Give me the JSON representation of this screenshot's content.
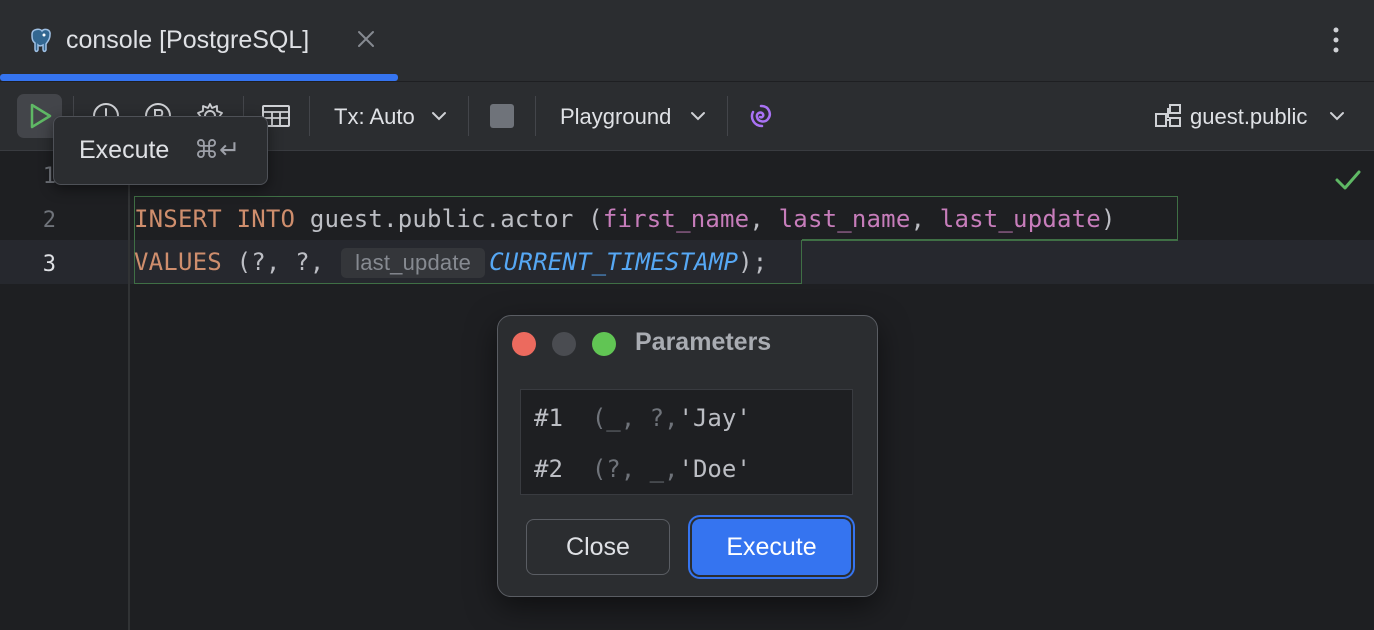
{
  "tab": {
    "title": "console [PostgreSQL]",
    "icon": "postgresql-elephant-icon"
  },
  "toolbar": {
    "run_icon": "run-icon",
    "tx_label": "Tx: Auto",
    "mode_label": "Playground",
    "schema_label": "guest.public"
  },
  "tooltip": {
    "label": "Execute",
    "shortcut": "⌘↵"
  },
  "editor": {
    "line_numbers": [
      "1",
      "2",
      "3"
    ],
    "line2": {
      "kw1": "INSERT",
      "kw2": "INTO",
      "table": "guest.public.actor",
      "open": "(",
      "col1": "first_name",
      "col2": "last_name",
      "col3": "last_update",
      "close": ")"
    },
    "line3": {
      "kw": "VALUES",
      "params": "(?, ?,",
      "hint": "last_update",
      "fn": "CURRENT_TIMESTAMP",
      "end": ");"
    }
  },
  "dialog": {
    "title": "Parameters",
    "params": [
      {
        "num": "#1",
        "ctx": "(_, ?,",
        "value": "'Jay'"
      },
      {
        "num": "#2",
        "ctx": "(?, _,",
        "value": "'Doe'"
      }
    ],
    "close_label": "Close",
    "execute_label": "Execute"
  },
  "colors": {
    "accent": "#3574f0",
    "keyword": "#cf8e6d",
    "column": "#c77dbb",
    "function": "#56a8f5",
    "ok_check": "#5fb865"
  }
}
